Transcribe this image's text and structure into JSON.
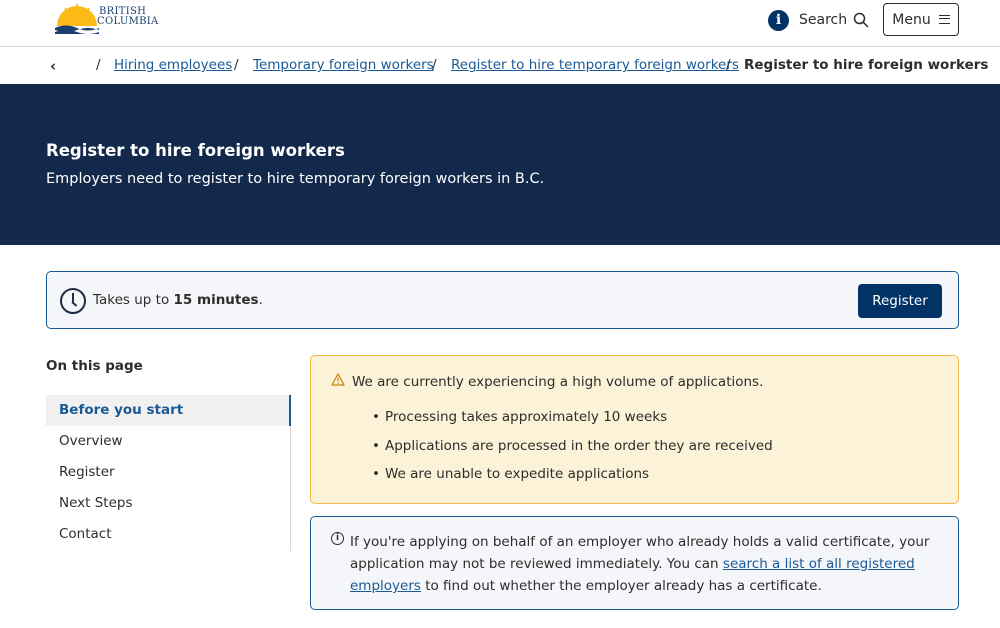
{
  "header": {
    "logo_line1": "BRITISH",
    "logo_line2": "COLUMBIA",
    "info_icon": "i",
    "search_label": "Search",
    "menu_label": "Menu"
  },
  "breadcrumb": {
    "back_icon": "‹",
    "items": [
      {
        "label": "Hiring employees"
      },
      {
        "label": "Temporary foreign workers"
      },
      {
        "label": "Register to hire temporary foreign workers"
      }
    ],
    "current": "Register to hire foreign workers",
    "separator": "/"
  },
  "banner": {
    "title": "Register to hire foreign workers",
    "subtitle": "Employers need to register to hire temporary foreign workers in B.C."
  },
  "time_box": {
    "prefix": "Takes up to ",
    "duration": "15 minutes",
    "suffix": ".",
    "button_label": "Register"
  },
  "on_this_page": {
    "title": "On this page",
    "items": [
      {
        "label": "Before you start"
      },
      {
        "label": "Overview"
      },
      {
        "label": "Register"
      },
      {
        "label": "Next Steps"
      },
      {
        "label": "Contact"
      }
    ]
  },
  "warning": {
    "lead": "We are currently experiencing a high volume of applications.",
    "items": [
      "Processing takes approximately 10 weeks",
      "Applications are processed in the order they are received",
      "We are unable to expedite applications"
    ]
  },
  "info": {
    "text_before": "If you're applying on behalf of an employer who already holds a valid certificate, your application may not be reviewed immediately. You can ",
    "link_text": "search a list of all registered employers",
    "text_after": " to find out whether the employer already has a certificate."
  },
  "colors": {
    "navy": "#013366",
    "banner_bg": "#13294b",
    "link": "#1a5a96",
    "warning_bg": "#fcf2d7",
    "warning_border": "#f8bb47"
  }
}
